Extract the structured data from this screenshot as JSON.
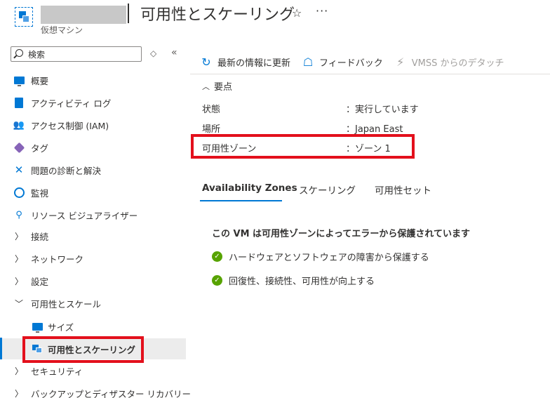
{
  "header": {
    "title": "可用性とスケーリング",
    "subtitle": "仮想マシン",
    "favorite_icon": "☆",
    "more_icon": "···"
  },
  "sidebar": {
    "search_placeholder": "検索",
    "items": [
      {
        "label": "概要"
      },
      {
        "label": "アクティビティ ログ"
      },
      {
        "label": "アクセス制御 (IAM)"
      },
      {
        "label": "タグ"
      },
      {
        "label": "問題の診断と解決"
      },
      {
        "label": "監視"
      },
      {
        "label": "リソース ビジュアライザー"
      },
      {
        "label": "接続"
      },
      {
        "label": "ネットワーク"
      },
      {
        "label": "設定"
      },
      {
        "label": "可用性とスケール"
      },
      {
        "label": "サイズ"
      },
      {
        "label": "可用性とスケーリング"
      },
      {
        "label": "セキュリティ"
      },
      {
        "label": "バックアップとディザスター リカバリー"
      }
    ]
  },
  "toolbar": {
    "refresh_label": "最新の情報に更新",
    "feedback_label": "フィードバック",
    "detach_label": "VMSS からのデタッチ"
  },
  "essentials": {
    "heading": "要点",
    "props": [
      {
        "label": "状態",
        "value": "：実行しています"
      },
      {
        "label": "場所",
        "value": "：Japan East"
      },
      {
        "label": "可用性ゾーン",
        "value": "：ゾーン 1"
      }
    ]
  },
  "tabs": [
    {
      "label": "Availability Zones"
    },
    {
      "label": "スケーリング"
    },
    {
      "label": "可用性セット"
    }
  ],
  "zones": {
    "title": "この VM は可用性ゾーンによってエラーから保護されています",
    "checks": [
      {
        "text": "ハードウェアとソフトウェアの障害から保護する"
      },
      {
        "text": "回復性、接続性、可用性が向上する"
      }
    ]
  },
  "colors": {
    "accent": "#0078d4",
    "highlight": "#e3101c",
    "success": "#57a300"
  }
}
